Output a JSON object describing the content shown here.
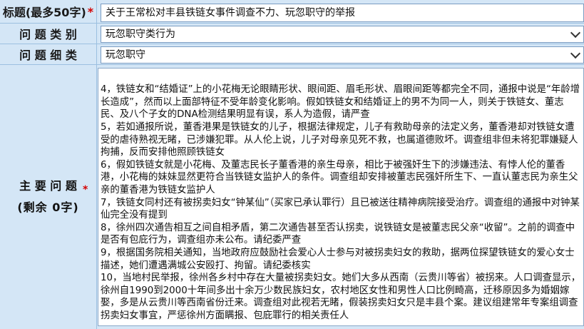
{
  "title_row": {
    "label": "标题(最多50字)",
    "required_mark": "*",
    "value": "关于王常松对丰县铁链女事件调查不力、玩忽职守的举报"
  },
  "category_row": {
    "label": "问 题 类 别",
    "value": "玩忽职守类行为"
  },
  "subcategory_row": {
    "label": "问 题 细 类",
    "value": "玩忽职守"
  },
  "issue_row": {
    "label_line1": "主 要 问 题",
    "label_line2": "(剩余  0字)",
    "required_mark": "*",
    "text": "4，铁链女和“结婚证”上的小花梅无论眼睛形状、眼间距、眉毛形状、眉眼间距等都完全不同，通报中说是“年龄增长造成”，然而以上面部特征不受年龄变化影响。假如铁链女和结婚证上的男不为同一人，则关于铁链女、董志民、及八个子女的DNA检测结果明显有误，系人为造假，请严查\n5，若如通报所说，董香港果是铁链女的儿子，根据法律规定，儿子有救助母亲的法定义务，董香港却对铁链女遭受的虐待熟视无睹，已涉嫌犯罪。从人伦上说，儿子对母亲见死不救，也属道德败坏。调查组非但未将犯罪嫌疑人拘捕，反而安排他照顾铁链女\n6，假如铁链女就是小花梅、及董志民长子董香港的亲生母亲，相比于被强奸生下的涉嫌违法、有悖人伦的董香港，小花梅的妹妹显然更符合当铁链女监护人的条件。调查组却安排被董志民强奸所生下、一直认董志民为亲生父亲的董香港为铁链女监护人\n7，铁链女同村还有被拐卖妇女“钟某仙”（买家已承认罪行）且已被送往精神病院接受治疗。调查组的通报中对钟某仙完全没有提到\n8，徐州四次通告相互之间自相矛盾，第二次通告甚至否认拐卖，说铁链女是被董志民父亲“收留”。之前的调查中是否有包庇行为，调查组亦未公布。请纪委严查\n9，根据国务院相关通知，当地政府应鼓励社会爱心人士参与对被拐卖妇女的救助，据两位探望铁链女的爱心女士描述，她们遭遇满城公安殴打、拘留。请纪委核实\n10，当地村民举报，徐州各乡村中存在大量被拐卖妇女。她们大多从西南（云贵川等省）被拐来。人口调查显示，徐州自1990到2000十年间多出十余万少数民族妇女，农村地区女性和男性人口比例畸高，迁移原因多为婚姻嫁娶，多是从云贵川等西南省份迁来。调查组对此视若无睹，假装拐卖妇女只是丰县个案。建议组建常年专案组调查拐卖妇女事宜，严惩徐州方面瞒报、包庇罪行的相关责任人"
  }
}
